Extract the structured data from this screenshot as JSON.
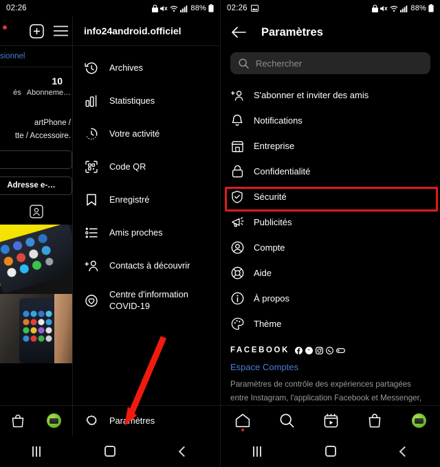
{
  "status_bar": {
    "time": "02:26",
    "battery_text": "88%",
    "icons": [
      "image-icon",
      "lock-icon",
      "mute-icon",
      "wifi-icon",
      "signal-icon",
      "battery-icon"
    ]
  },
  "left_panel": {
    "profile": {
      "professional_link": "sionnel",
      "stat_number": "10",
      "stat_label_partial": "és",
      "stat_label": "Abonneme…",
      "bio_line1": "artPhone /",
      "bio_line2": "tte / Accessoire.",
      "email_button": "Adresse e-…",
      "top_icons": [
        "add-post-icon",
        "hamburger-menu-icon"
      ],
      "tagged_icon": "tagged-photos-icon"
    },
    "drawer": {
      "title": "info24android.officiel",
      "items": [
        {
          "label": "Archives",
          "icon": "archive-clock-icon"
        },
        {
          "label": "Statistiques",
          "icon": "bar-chart-icon"
        },
        {
          "label": "Votre activité",
          "icon": "activity-clock-icon"
        },
        {
          "label": "Code QR",
          "icon": "qr-code-icon"
        },
        {
          "label": "Enregistré",
          "icon": "bookmark-icon"
        },
        {
          "label": "Amis proches",
          "icon": "close-friends-list-icon"
        },
        {
          "label": "Contacts à découvrir",
          "icon": "discover-people-icon"
        },
        {
          "label": "Centre d'information COVID-19",
          "icon": "covid-info-icon"
        }
      ],
      "footer": {
        "label": "Paramètres",
        "icon": "gear-icon"
      }
    },
    "tabbar": [
      {
        "name": "shop-tab",
        "icon": "shop-bag-icon"
      },
      {
        "name": "profile-tab",
        "icon": "avatar-icon"
      }
    ]
  },
  "right_panel": {
    "header": {
      "back_icon": "back-arrow-icon",
      "title": "Paramètres"
    },
    "search": {
      "placeholder": "Rechercher",
      "icon": "search-icon",
      "value": ""
    },
    "items": [
      {
        "label": "S'abonner et inviter des amis",
        "icon": "add-person-icon",
        "highlighted": false
      },
      {
        "label": "Notifications",
        "icon": "bell-icon",
        "highlighted": false
      },
      {
        "label": "Entreprise",
        "icon": "storefront-icon",
        "highlighted": false
      },
      {
        "label": "Confidentialité",
        "icon": "lock-icon",
        "highlighted": false
      },
      {
        "label": "Sécurité",
        "icon": "shield-check-icon",
        "highlighted": true
      },
      {
        "label": "Publicités",
        "icon": "megaphone-icon",
        "highlighted": false
      },
      {
        "label": "Compte",
        "icon": "account-circle-icon",
        "highlighted": false
      },
      {
        "label": "Aide",
        "icon": "life-ring-icon",
        "highlighted": false
      },
      {
        "label": "À propos",
        "icon": "info-circle-icon",
        "highlighted": false
      },
      {
        "label": "Thème",
        "icon": "palette-icon",
        "highlighted": false
      }
    ],
    "facebook_block": {
      "brand": "FACEBOOK",
      "brand_icons": [
        "facebook-icon",
        "messenger-icon",
        "instagram-icon",
        "whatsapp-icon",
        "portal-icon"
      ],
      "link": "Espace Comptes",
      "description": "Paramètres de contrôle des expériences partagées entre Instagram, l'application Facebook et Messenger, notamment pour le partage de stories et de"
    },
    "tabbar": [
      {
        "name": "home-tab",
        "icon": "home-icon"
      },
      {
        "name": "search-tab",
        "icon": "search-icon"
      },
      {
        "name": "reels-tab",
        "icon": "reels-icon"
      },
      {
        "name": "shop-tab",
        "icon": "shop-bag-icon"
      },
      {
        "name": "profile-tab",
        "icon": "avatar-icon"
      }
    ]
  },
  "nav_bar": {
    "recent_icon": "recent-apps-icon",
    "home_icon": "home-square-icon",
    "back_icon": "back-chevron-icon"
  },
  "annotations": {
    "highlight_color": "#e01b20",
    "arrow_color": "#f01a0f",
    "arrow_target": "Paramètres",
    "highlight_target": "Sécurité"
  }
}
